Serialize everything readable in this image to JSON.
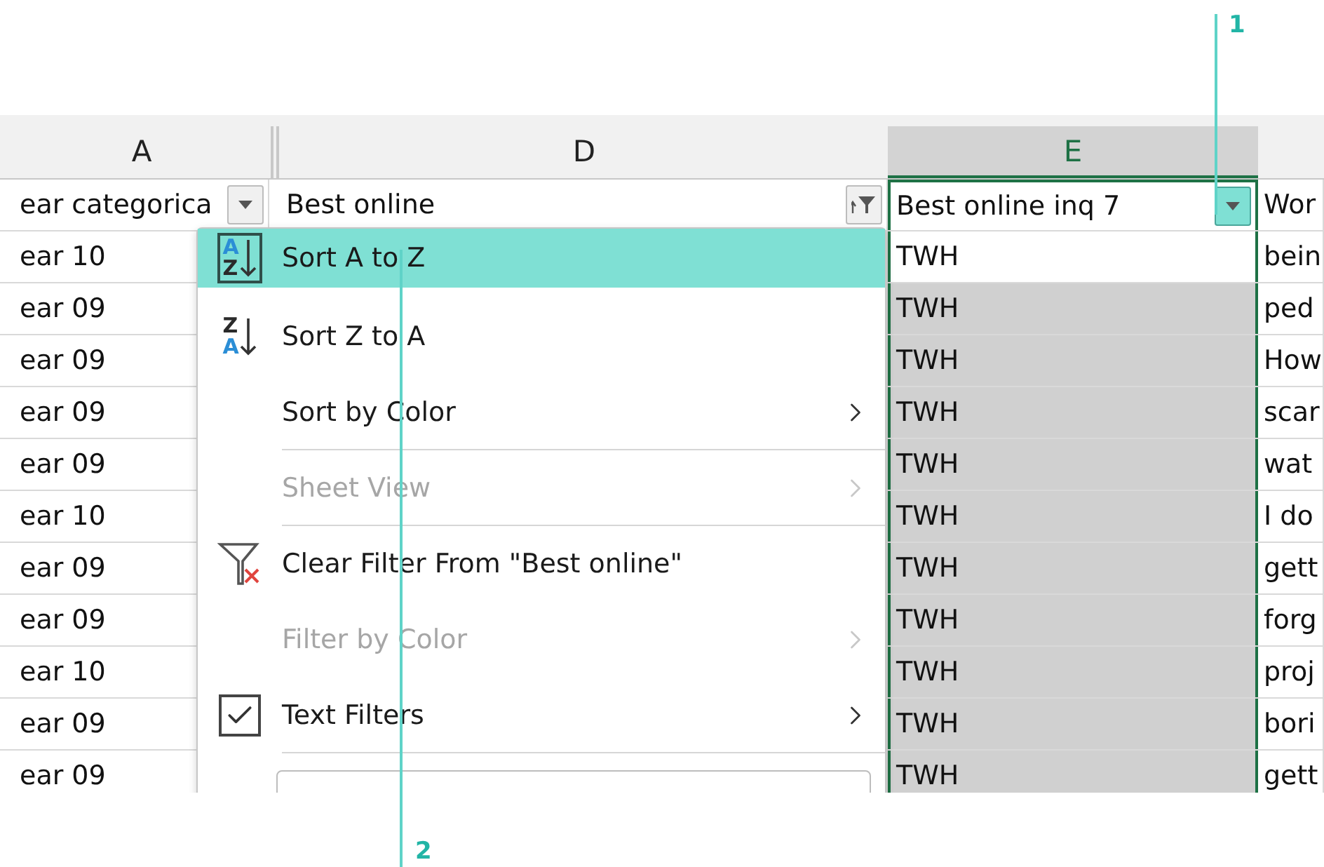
{
  "callouts": [
    {
      "label": "1"
    },
    {
      "label": "2"
    }
  ],
  "sheet": {
    "column_headers": [
      {
        "label": "A",
        "selected": false
      },
      {
        "label": "D",
        "selected": false
      },
      {
        "label": "E",
        "selected": true
      }
    ],
    "filter_row": [
      {
        "label": "ear categorica",
        "kind": "dropdown"
      },
      {
        "label": "Best online",
        "kind": "filtered"
      },
      {
        "label": "Best online inq 7",
        "kind": "open"
      },
      {
        "label": "Wor",
        "kind": "none"
      }
    ],
    "rows": [
      {
        "column_a": "ear 10",
        "column_e": "TWH",
        "column_f": "bein",
        "active": true
      },
      {
        "column_a": "ear 09",
        "column_e": "TWH",
        "column_f": "ped",
        "active": false
      },
      {
        "column_a": "ear 09",
        "column_e": "TWH",
        "column_f": "How",
        "active": false
      },
      {
        "column_a": "ear 09",
        "column_e": "TWH",
        "column_f": "scar",
        "active": false
      },
      {
        "column_a": "ear 09",
        "column_e": "TWH",
        "column_f": "wat",
        "active": false
      },
      {
        "column_a": "ear 10",
        "column_e": "TWH",
        "column_f": "I do",
        "active": false
      },
      {
        "column_a": "ear 09",
        "column_e": "TWH",
        "column_f": "gett",
        "active": false
      },
      {
        "column_a": "ear 09",
        "column_e": "TWH",
        "column_f": "forg",
        "active": false
      },
      {
        "column_a": "ear 10",
        "column_e": "TWH",
        "column_f": "proj",
        "active": false
      },
      {
        "column_a": "ear 09",
        "column_e": "TWH",
        "column_f": "bori",
        "active": false
      },
      {
        "column_a": "ear 09",
        "column_e": "TWH",
        "column_f": "gett",
        "active": false
      }
    ]
  },
  "menu": {
    "items": [
      {
        "label": "Sort A to Z",
        "icon": {
          "kind": "sort_ascending",
          "top": "A",
          "bottom": "Z"
        },
        "highlighted": true,
        "disabled": false,
        "submenu": false,
        "divider_after": false
      },
      {
        "label": "Sort Z to A",
        "icon": {
          "kind": "sort_descending",
          "top": "Z",
          "bottom": "A"
        },
        "highlighted": false,
        "disabled": false,
        "submenu": false,
        "divider_after": false
      },
      {
        "label": "Sort by Color",
        "highlighted": false,
        "disabled": false,
        "submenu": true,
        "divider_after": true
      },
      {
        "label": "Sheet View",
        "highlighted": false,
        "disabled": true,
        "submenu": true,
        "divider_after": true
      },
      {
        "label": "Clear Filter From \"Best online\"",
        "icon": {
          "kind": "clear_filter"
        },
        "highlighted": false,
        "disabled": false,
        "submenu": false,
        "divider_after": false
      },
      {
        "label": "Filter by Color",
        "highlighted": false,
        "disabled": true,
        "submenu": true,
        "divider_after": false
      },
      {
        "label": "Text Filters",
        "icon": {
          "kind": "checkbox",
          "checked": true
        },
        "highlighted": false,
        "disabled": false,
        "submenu": true,
        "divider_after": true
      }
    ]
  }
}
